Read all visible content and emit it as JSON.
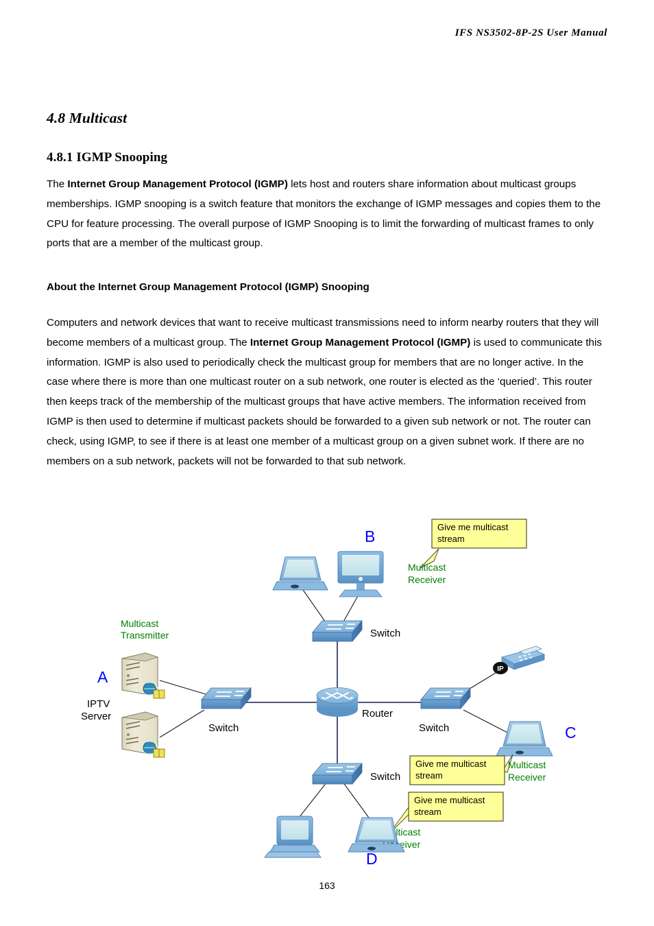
{
  "header": {
    "manual_title": "IFS  NS3502-8P-2S  User  Manual"
  },
  "section": {
    "number_title": "4.8 Multicast",
    "subsection_title": "4.8.1 IGMP Snooping"
  },
  "paragraphs": {
    "intro_pre": "The ",
    "intro_bold": "Internet Group Management Protocol (IGMP)",
    "intro_post": " lets host and routers share information about multicast groups memberships. IGMP snooping is a switch feature that monitors the exchange of IGMP messages and copies them to the CPU for feature processing. The overall purpose of IGMP Snooping is to limit the forwarding of multicast frames to only ports that are a member of the multicast group.",
    "about_heading": "About the Internet Group Management Protocol (IGMP) Snooping",
    "about_pre": "Computers and network devices that want to receive multicast transmissions need to inform nearby routers that they will become members of a multicast group. The ",
    "about_bold": "Internet Group Management Protocol (IGMP)",
    "about_post": " is used to communicate this information. IGMP is also used to periodically check the multicast group for members that are no longer active. In the case where there is more than one multicast router on a sub network, one router is elected as the ‘queried’. This router then keeps track of the membership of the multicast groups that have active members. The information received from IGMP is then used to determine if multicast packets should be forwarded to a given sub network or not. The router can check, using IGMP, to see if there is at least one member of a multicast group on a given subnet work. If there are no members on a sub network, packets will not be forwarded to that sub network."
  },
  "figure": {
    "labels": {
      "node_a": "A",
      "node_b": "B",
      "node_c": "C",
      "node_d": "D",
      "multicast_transmitter": "Multicast\nTransmitter",
      "multicast_transmitter_line1": "Multicast",
      "multicast_transmitter_line2": "Transmitter",
      "iptv_server_line1": "IPTV",
      "iptv_server_line2": "Server",
      "multicast_receiver_line1": "Multicast",
      "multicast_receiver_line2": "Receiver",
      "switch_top": "Switch",
      "switch_left": "Switch",
      "switch_right": "Switch",
      "switch_bottom": "Switch",
      "router": "Router",
      "ip_phone_badge": "IP"
    },
    "callouts": {
      "line1": "Give me multicast",
      "line2": "stream"
    },
    "colors": {
      "callout_fill": "#FFFF99",
      "callout_border": "#4F4F2F",
      "label_green": "#008000",
      "label_blue": "#0000FF",
      "device_blue": "#6FA8D6",
      "device_blue_dark": "#3E78B2",
      "screen_cyan": "#CFE8EE",
      "link_line": "#3B3B6E",
      "server_beige": "#E8E4CE"
    }
  },
  "footer": {
    "page_number": "163"
  }
}
